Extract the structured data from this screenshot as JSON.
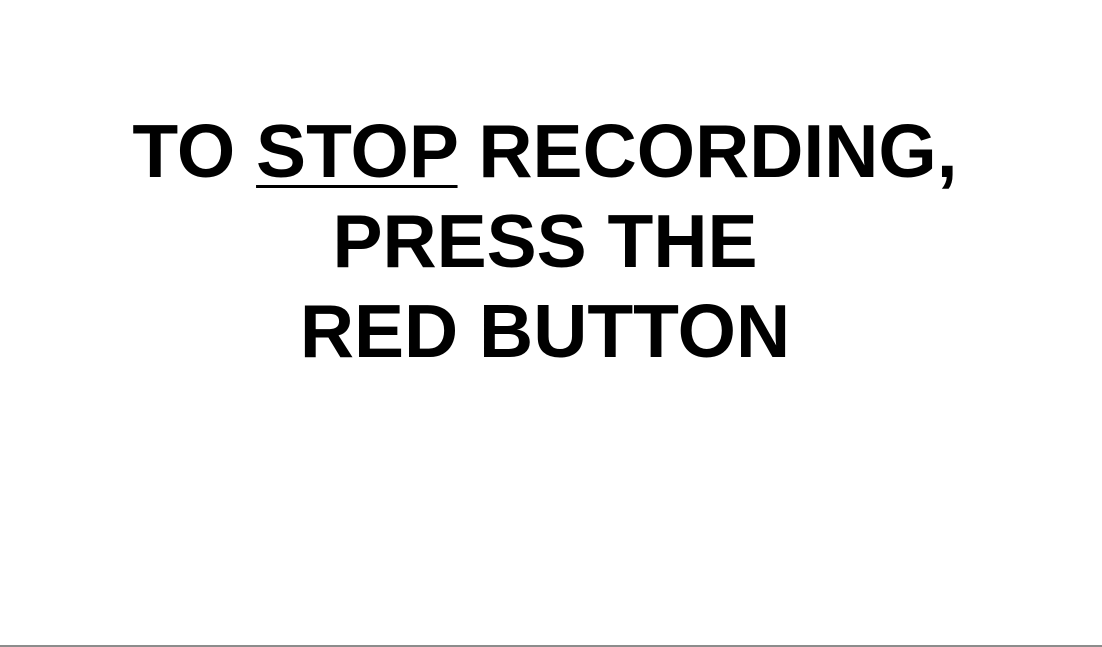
{
  "message": {
    "line1_before": "TO ",
    "line1_emphasis": "STOP",
    "line1_after": " RECORDING,",
    "line2": "PRESS THE",
    "line3": "RED BUTTON"
  },
  "colors": {
    "background": "#ffffff",
    "text": "#000000",
    "border": "#8c8c8c"
  }
}
